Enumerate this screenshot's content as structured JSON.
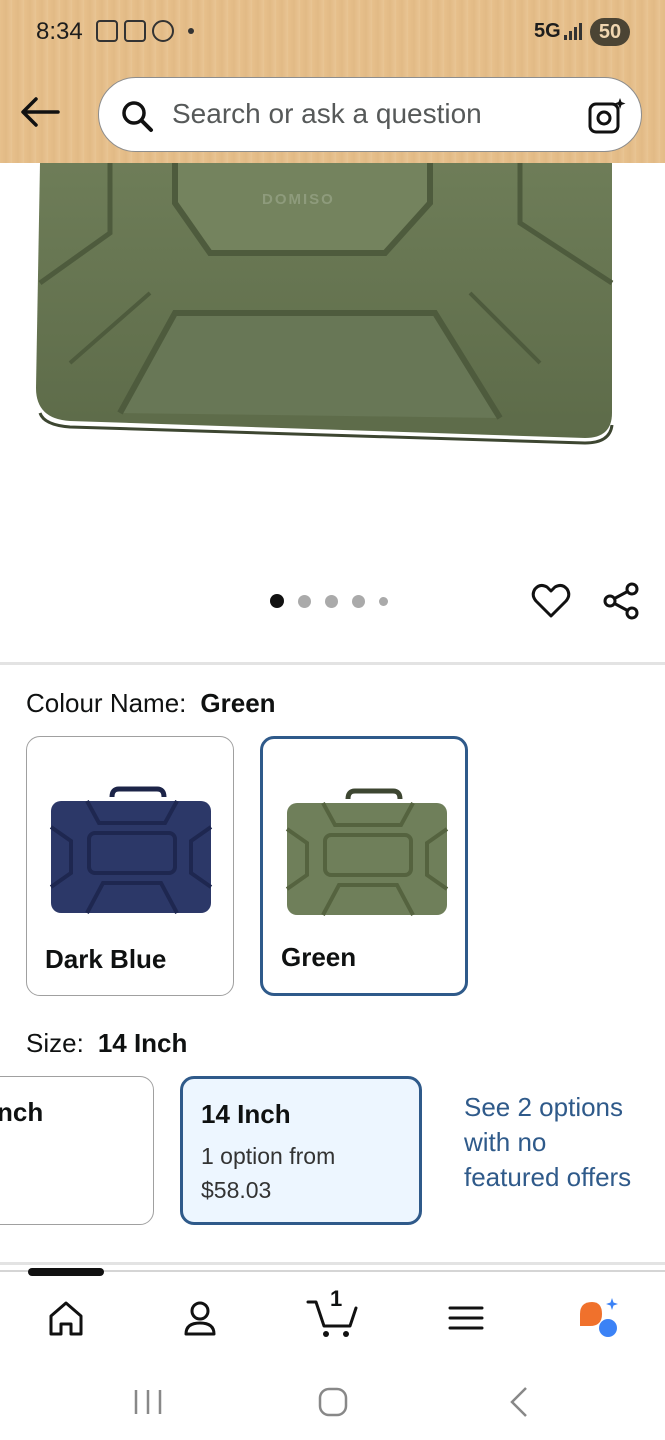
{
  "status_bar": {
    "time": "8:34",
    "network": "5G",
    "battery": "50"
  },
  "search": {
    "placeholder": "Search or ask a question"
  },
  "product": {
    "brand_mark": "DOMISO",
    "image_count": 5,
    "active_image_index": 0
  },
  "colour": {
    "label": "Colour Name:",
    "selected": "Green",
    "options": [
      {
        "name": "Dark Blue",
        "color": "#2c3868",
        "selected": false
      },
      {
        "name": "Green",
        "color": "#6f7f5a",
        "selected": true
      }
    ]
  },
  "size": {
    "label": "Size:",
    "selected": "14 Inch",
    "options": [
      {
        "title": "nch",
        "line1": "",
        "line2": "",
        "selected": false
      },
      {
        "title": "14 Inch",
        "line1": "1 option from",
        "line2": "$58.03",
        "selected": true
      }
    ],
    "see_more": "See 2 options with no featured offers"
  },
  "bottom_nav": {
    "cart_count": "1",
    "items": [
      "home-icon",
      "account-icon",
      "cart-icon",
      "menu-icon",
      "rufus-icon"
    ]
  },
  "colors": {
    "header_bg": "#e7c08c",
    "accent_blue": "#2f5a8a",
    "product_green": "#6f7f5a"
  }
}
